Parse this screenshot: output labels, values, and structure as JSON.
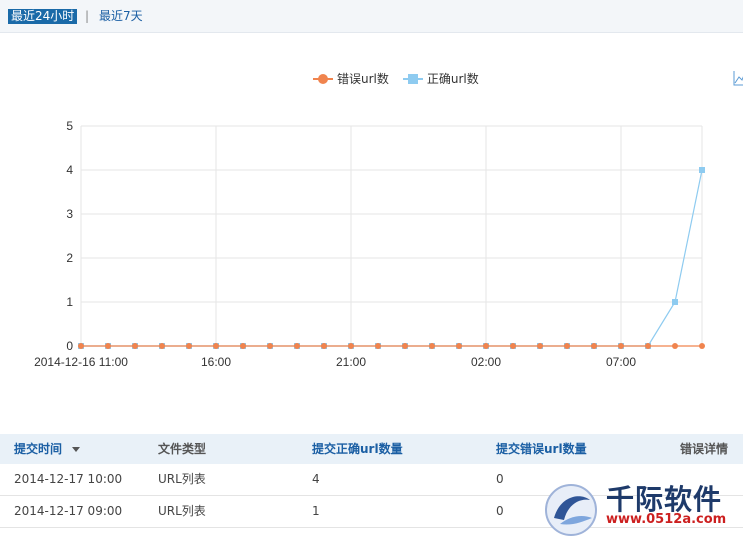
{
  "tabs": [
    {
      "label": "最近24小时",
      "active": true
    },
    {
      "label": "最近7天",
      "active": false
    }
  ],
  "tab_separator": "|",
  "legend": [
    {
      "label": "错误url数",
      "color": "#f0844e",
      "marker": "circle"
    },
    {
      "label": "正确url数",
      "color": "#8ecbf0",
      "marker": "square"
    }
  ],
  "chart_tool_icon": "line-chart-icon",
  "chart_data": {
    "type": "line",
    "x": [
      "2014-12-16 11:00",
      "12:00",
      "13:00",
      "14:00",
      "15:00",
      "16:00",
      "17:00",
      "18:00",
      "19:00",
      "20:00",
      "21:00",
      "22:00",
      "23:00",
      "00:00",
      "01:00",
      "02:00",
      "03:00",
      "04:00",
      "05:00",
      "06:00",
      "07:00",
      "08:00",
      "09:00",
      "10:00"
    ],
    "x_tick_labels": [
      "2014-12-16 11:00",
      "16:00",
      "21:00",
      "02:00",
      "07:00"
    ],
    "series": [
      {
        "name": "错误url数",
        "color": "#f0844e",
        "values": [
          0,
          0,
          0,
          0,
          0,
          0,
          0,
          0,
          0,
          0,
          0,
          0,
          0,
          0,
          0,
          0,
          0,
          0,
          0,
          0,
          0,
          0,
          0,
          0
        ]
      },
      {
        "name": "正确url数",
        "color": "#8ecbf0",
        "values": [
          0,
          0,
          0,
          0,
          0,
          0,
          0,
          0,
          0,
          0,
          0,
          0,
          0,
          0,
          0,
          0,
          0,
          0,
          0,
          0,
          0,
          0,
          1,
          4
        ]
      }
    ],
    "ylim": [
      0,
      5
    ],
    "y_ticks": [
      "0",
      "1",
      "2",
      "3",
      "4",
      "5"
    ],
    "grid": true,
    "legend_position": "top-center"
  },
  "table": {
    "headers": [
      "提交时间",
      "文件类型",
      "提交正确url数量",
      "提交错误url数量",
      "错误详情"
    ],
    "sort_icon": "sort-desc-icon",
    "rows": [
      [
        "2014-12-17 10:00",
        "URL列表",
        "4",
        "0",
        ""
      ],
      [
        "2014-12-17 09:00",
        "URL列表",
        "1",
        "0",
        ""
      ]
    ]
  },
  "watermark": {
    "brand": "千际软件",
    "url": "www.0512a.com"
  }
}
